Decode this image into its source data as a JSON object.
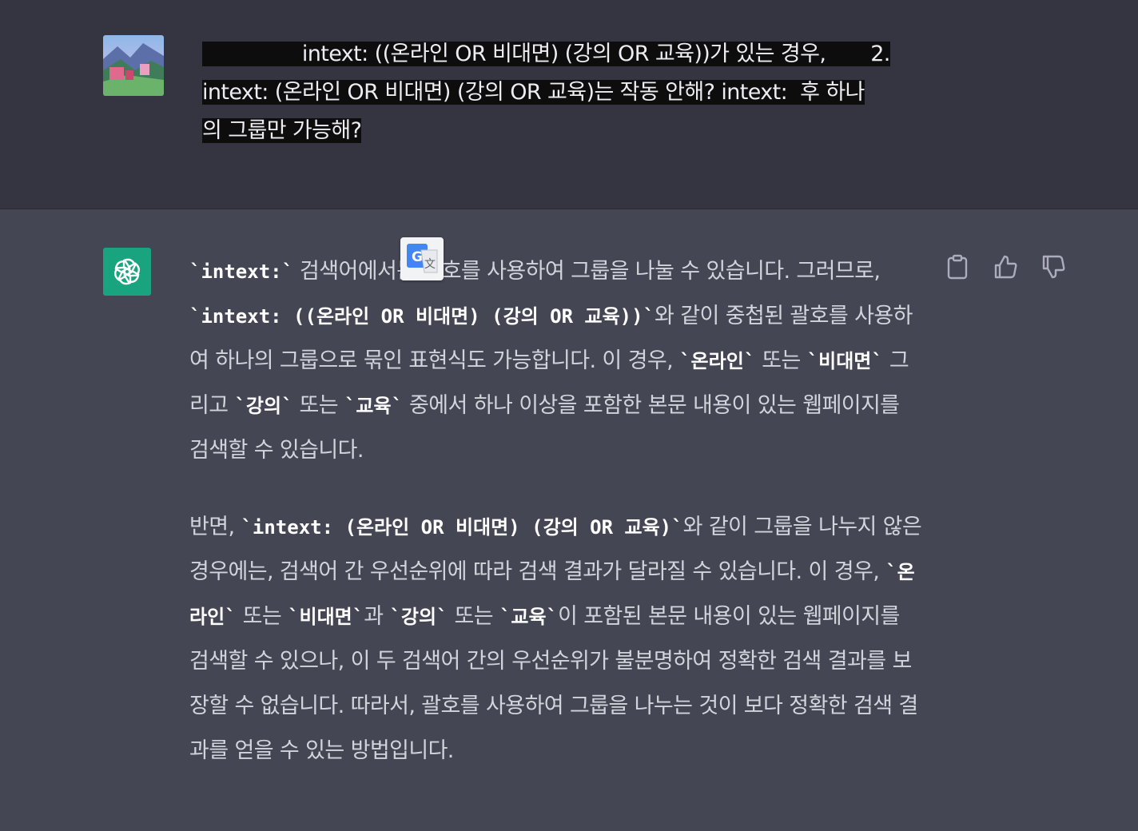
{
  "user_message": {
    "line1": "        intext: ((온라인 OR 비대면) (강의 OR 교육))가 있는 경우,       2.",
    "line2": "intext: (온라인 OR 비대면) (강의 OR 교육)는 작동 안해? intext:  후 하나",
    "line3": "의 그룹만 가능해?"
  },
  "assistant_message": {
    "p1": {
      "code1": "`intext:`",
      "t1": " 검색어에서는 괄호를 사용하여 그룹을 나눌 수 있습니다. 그러므로, ",
      "code2": "`intext: ((온라인 OR 비대면) (강의 OR 교육))`",
      "t2": "와 같이 중첩된 괄호를 사용하여 하나의 그룹으로 묶인 표현식도 가능합니다. 이 경우, ",
      "code3": "`온라인`",
      "t3": " 또는 ",
      "code4": "`비대면`",
      "t4": " 그리고 ",
      "code5": "`강의`",
      "t5": " 또는 ",
      "code6": "`교육`",
      "t6": " 중에서 하나 이상을 포함한 본문 내용이 있는 웹페이지를 검색할 수 있습니다."
    },
    "p2": {
      "t1": "반면, ",
      "code1": "`intext: (온라인 OR 비대면) (강의 OR 교육)`",
      "t2": "와 같이 그룹을 나누지 않은 경우에는, 검색어 간 우선순위에 따라 검색 결과가 달라질 수 있습니다. 이 경우, ",
      "code2": "`온라인`",
      "t3": " 또는 ",
      "code3": "`비대면`",
      "t4": "과 ",
      "code4": "`강의`",
      "t5": " 또는 ",
      "code5": "`교육`",
      "t6": "이 포함된 본문 내용이 있는 웹페이지를 검색할 수 있으나, 이 두 검색어 간의 우선순위가 불분명하여 정확한 검색 결과를 보장할 수 없습니다. 따라서, 괄호를 사용하여 그룹을 나누는 것이 보다 정확한 검색 결과를 얻을 수 있는 방법입니다."
    }
  },
  "icons": {
    "copy": "clipboard-icon",
    "thumbs_up": "thumbs-up-icon",
    "thumbs_down": "thumbs-down-icon",
    "translate": "google-translate-icon",
    "assistant_logo": "openai-logo-icon"
  },
  "colors": {
    "user_bg": "#343541",
    "assistant_bg": "#444654",
    "assistant_avatar": "#19a37f"
  }
}
